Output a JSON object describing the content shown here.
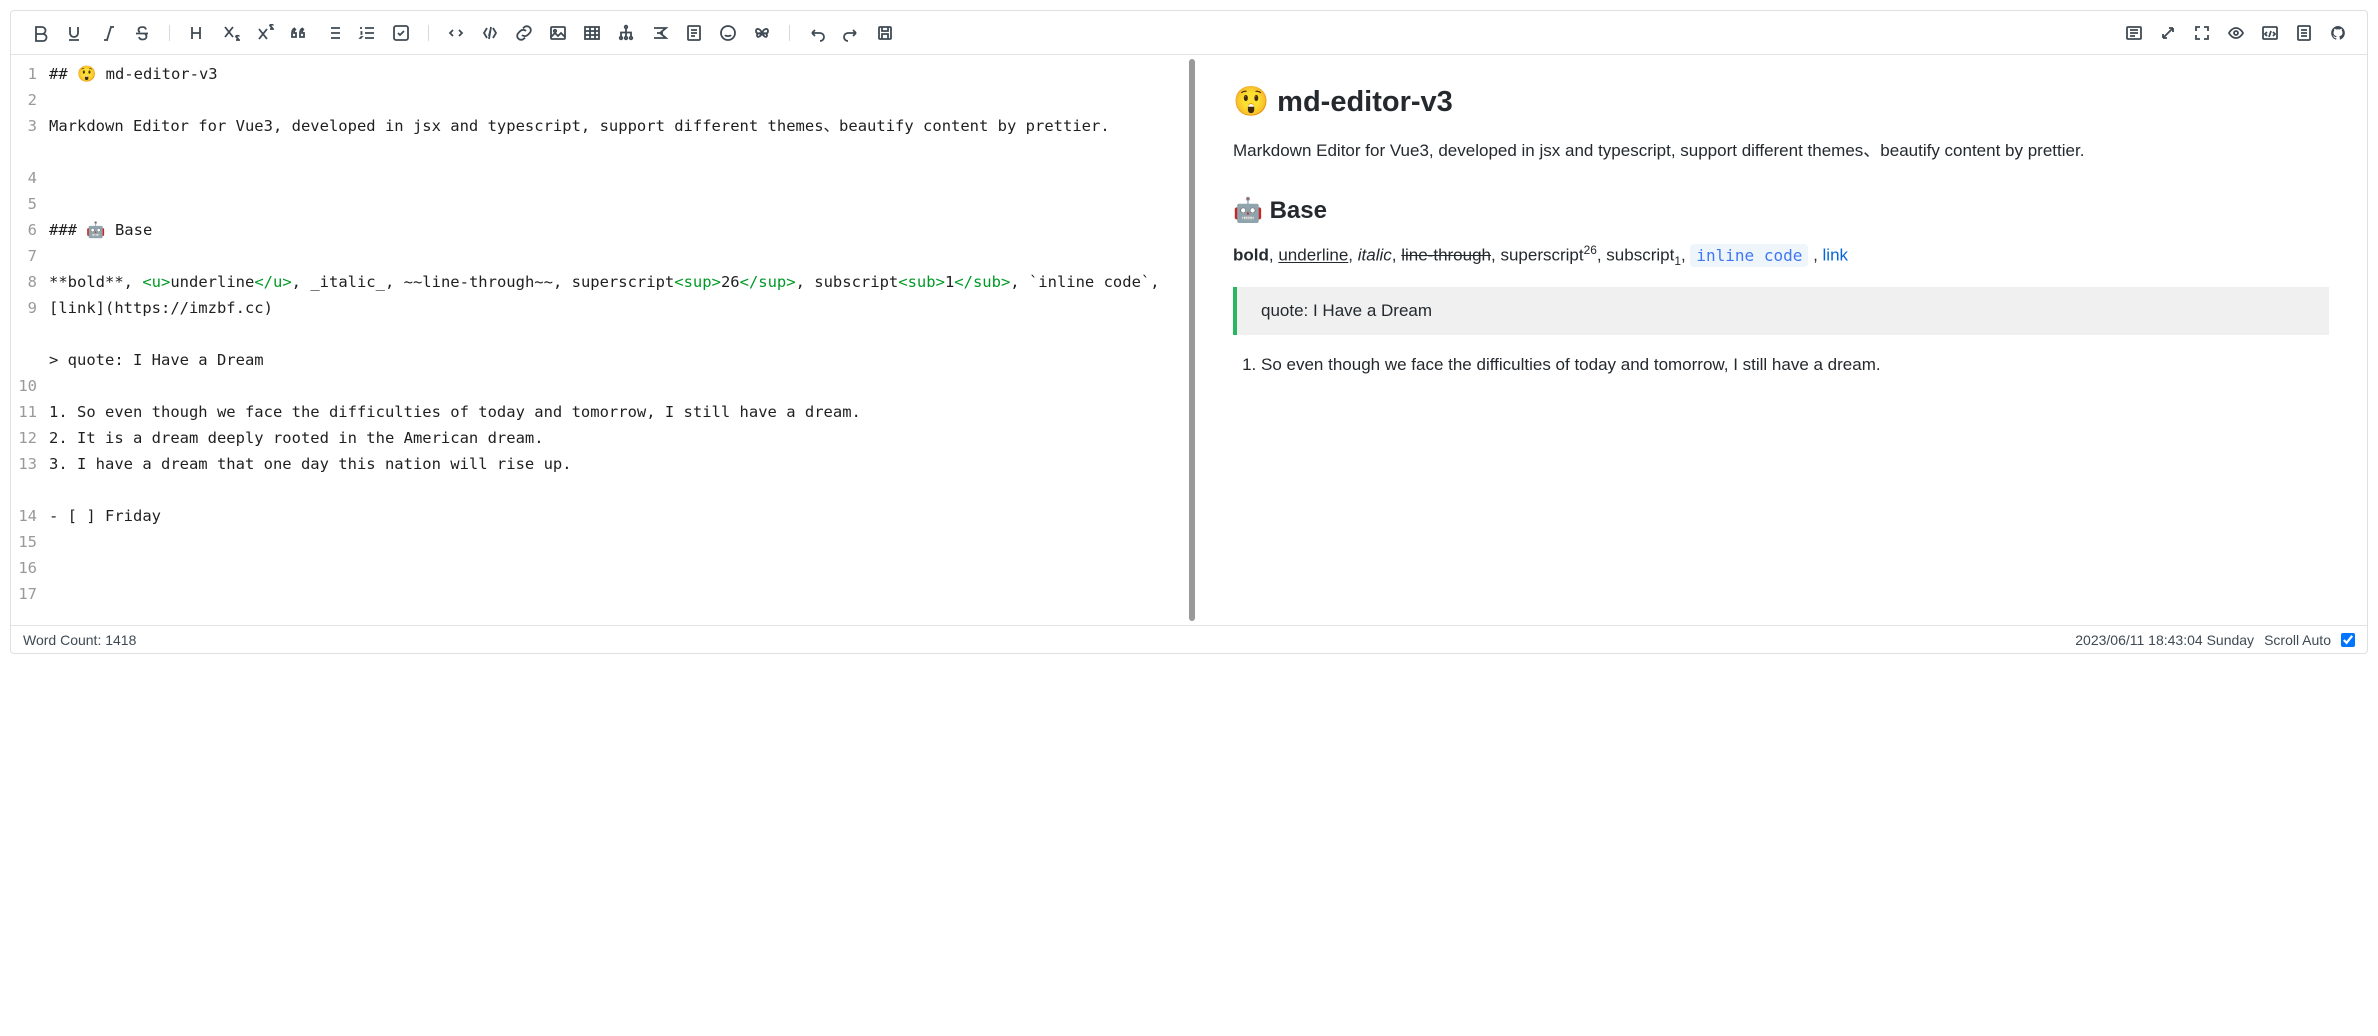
{
  "toolbar": {
    "left": [
      {
        "name": "bold",
        "svg": "<path d='M5 3h6a3.5 3.5 0 010 7H5zM5 10h7a3.5 3.5 0 010 7H5z'/>"
      },
      {
        "name": "underline",
        "svg": "<path d='M5 3v6a4 4 0 008 0V3M4 16h10'/>"
      },
      {
        "name": "italic",
        "svg": "<path d='M11 3h4M5 16h4M12 3l-4 13'/>"
      },
      {
        "name": "strikethrough",
        "svg": "<path d='M13 5.5a3.5 3.5 0 00-3.5-2.5C7 3 5.5 4 5.5 6c0 1 .5 1.7 1.5 2M3 9.5h12M6 13a3.5 3.5 0 003.5 2.5c2.5 0 4-1.2 4-3 0-1-.5-1.8-1.5-2.3'/>"
      },
      {
        "sep": true
      },
      {
        "name": "heading",
        "svg": "<path d='M4 3v12M12 3v12M4 9h8'/>"
      },
      {
        "name": "subscript",
        "svg": "<path d='M3 3l8 10M11 3L3 13M14 16h3l-3-3.5c0-1 3-1 3 0'/>"
      },
      {
        "name": "superscript",
        "svg": "<path d='M3 5l8 10M11 5L3 15M14 5h3l-3-3.5c0-1 3-1 3 0'/>"
      },
      {
        "name": "quote",
        "svg": "<path d='M5 4c-2 1-3 3-3 5v4h4V9H4c0-2 1-3.5 2-4M13 4c-2 1-3 3-3 5v4h4V9h-2c0-2 1-3.5 2-4'/>"
      },
      {
        "name": "ul",
        "svg": "<path d='M7 4h9M7 9h9M7 14h9M3 4h.01M3 9h.01M3 14h.01'/>"
      },
      {
        "name": "ol",
        "svg": "<path d='M7 4h9M7 9h9M7 14h9M3 3v2M2.5 8h1v2h-1M2.5 13h1l-1 1h1'/>"
      },
      {
        "name": "task",
        "svg": "<rect x='2' y='2' width='14' height='14' rx='2'/><path d='M6 9l2 2 4-4'/>"
      },
      {
        "sep": true
      },
      {
        "name": "code-block",
        "svg": "<path d='M6 6l-3 3 3 3M12 6l3 3-3 3'/>"
      },
      {
        "name": "code",
        "svg": "<path d='M6 4l-3 5 3 5M12 4l3 5-3 5M10 3l-2 12'/><text x='7' y='12' font-size='7' fill='#3f4a54' stroke='none'>/</text>",
        "raw": "{/}"
      },
      {
        "name": "link",
        "svg": "<path d='M7 11a4 4 0 005.66 0l2-2a4 4 0 00-5.66-5.66l-1 1M11 7a4 4 0 00-5.66 0l-2 2a4 4 0 005.66 5.66l1-1'/>"
      },
      {
        "name": "image",
        "svg": "<rect x='2' y='3' width='14' height='12' rx='1'/><circle cx='6' cy='7' r='1.2'/><path d='M2 13l4-4 3 3 3-3 4 4'/>"
      },
      {
        "name": "table",
        "svg": "<rect x='2' y='3' width='14' height='12'/><path d='M2 7h14M2 11h14M7 3v12M12 3v12'/>"
      },
      {
        "name": "tree",
        "svg": "<circle cx='9' cy='3' r='1.3'/><circle cx='4' cy='14' r='1.3'/><circle cx='9' cy='14' r='1.3'/><circle cx='14' cy='14' r='1.3'/><path d='M9 4.5v4M9 8.5H4v4M9 8.5v4M9 8.5h5v4'/>"
      },
      {
        "name": "formula",
        "svg": "<path d='M3 4h12l-6 5 6 5H3M6 9h6'/>"
      },
      {
        "name": "note",
        "svg": "<rect x='3' y='2' width='12' height='14' rx='1'/><path d='M6 6h6M6 9h6M6 12h4'/>"
      },
      {
        "name": "emoji",
        "svg": "<circle cx='9' cy='9' r='7'/><path d='M6 11c1 1.5 5 1.5 6 0M6.5 7h.01M11.5 7h.01'/>"
      },
      {
        "name": "butterfly",
        "svg": "<path d='M9 9c-2-5-6-5-6-2s3 3 6 2zM9 9c2-5 6-5 6-2s-3 3-6 2zM9 9c-1.5 4-5 5-5 2.5s2-2.5 5-2.5zM9 9c1.5 4 5 5 5 2.5S12 9 9 9z'/>"
      },
      {
        "sep": true
      },
      {
        "name": "undo",
        "svg": "<path d='M4 9h8a4 4 0 010 8M4 9l3-3M4 9l3 3'/>"
      },
      {
        "name": "redo",
        "svg": "<path d='M14 9H6a4 4 0 000 8M14 9l-3-3M14 9l-3 3'/>"
      },
      {
        "name": "save",
        "svg": "<rect x='3' y='3' width='12' height='12' rx='1'/><path d='M6 3v4h6V3M6 15v-5h6v5'/>"
      }
    ],
    "right": [
      {
        "name": "page-view",
        "svg": "<rect x='2' y='3' width='14' height='12' rx='1'/><path d='M5 6h8M5 9h8M5 12h5'/>"
      },
      {
        "name": "expand",
        "svg": "<path d='M4 14L14 4M14 4h-4M14 4v4M4 14h4M4 14v-4'/>"
      },
      {
        "name": "fullscreen",
        "svg": "<path d='M3 7V3h4M15 7V3h-4M3 11v4h4M15 11v4h-4'/>"
      },
      {
        "name": "preview",
        "svg": "<path d='M2 9s2.5-5 7-5 7 5 7 5-2.5 5-7 5-7-5-7-5z'/><circle cx='9' cy='9' r='2'/>"
      },
      {
        "name": "html-preview",
        "svg": "<rect x='2' y='3' width='14' height='12' rx='1'/><path d='M6 8l-2 2 2 2M12 8l2 2-2 2M10 7l-2 6'/>"
      },
      {
        "name": "catalog",
        "svg": "<rect x='3' y='2' width='12' height='14' rx='1'/><path d='M6 6h6M6 9h6M6 12h6'/>"
      },
      {
        "name": "github",
        "svg": "<path d='M9 2a7 7 0 00-2.2 13.6c.35.07.48-.15.48-.34v-1.2c-1.95.43-2.36-.94-2.36-.94-.32-.8-.78-1.02-.78-1.02-.64-.43.05-.43.05-.43.7.05 1.07.72 1.07.72.63 1.07 1.64.76 2.04.58.06-.45.24-.76.44-.94-1.56-.18-3.2-.78-3.2-3.46 0-.77.27-1.4.72-1.88-.07-.18-.31-.9.07-1.87 0 0 .59-.19 1.93.72a6.7 6.7 0 013.5 0c1.34-.9 1.93-.72 1.93-.72.38.98.14 1.7.07 1.87.45.49.72 1.12.72 1.88 0 2.7-1.64 3.28-3.2 3.46.25.22.47.64.47 1.3v1.92c0 .19.13.4.48.34A7 7 0 009 2z' fill='#3f4a54' stroke='none'/>"
      }
    ]
  },
  "editor": {
    "lines": [
      {
        "n": 1,
        "html": "## 😲 md-editor-v3"
      },
      {
        "n": 2,
        "html": ""
      },
      {
        "n": 3,
        "html": "Markdown Editor for Vue3, developed in jsx and typescript, support different themes、beautify content by prettier."
      },
      {
        "n": 4,
        "html": ""
      },
      {
        "n": 5,
        "html": ""
      },
      {
        "n": 6,
        "html": ""
      },
      {
        "n": 7,
        "html": "### 🤖 Base"
      },
      {
        "n": 8,
        "html": ""
      },
      {
        "n": 9,
        "html": "**bold**, <span class='tag'>&lt;u&gt;</span>underline<span class='tag'>&lt;/u&gt;</span>, _italic_, ~~line-through~~, superscript<span class='tag'>&lt;sup&gt;</span>26<span class='tag'>&lt;/sup&gt;</span>, subscript<span class='tag'>&lt;sub&gt;</span>1<span class='tag'>&lt;/sub&gt;</span>, `inline code`, [link](https://imzbf.cc)"
      },
      {
        "n": 10,
        "html": ""
      },
      {
        "n": 11,
        "html": "> quote: I Have a Dream"
      },
      {
        "n": 12,
        "html": ""
      },
      {
        "n": 13,
        "html": "1. So even though we face the difficulties of today and tomorrow, I still have a dream."
      },
      {
        "n": 14,
        "html": "2. It is a dream deeply rooted in the American dream."
      },
      {
        "n": 15,
        "html": "3. I have a dream that one day this nation will rise up."
      },
      {
        "n": 16,
        "html": ""
      },
      {
        "n": 17,
        "html": "- [ ] Friday"
      }
    ]
  },
  "preview": {
    "h2_emoji": "😲",
    "h2": "md-editor-v3",
    "p1": "Markdown Editor for Vue3, developed in jsx and typescript, support different themes、beautify content by prettier.",
    "h3_emoji": "🤖",
    "h3": "Base",
    "fmt": {
      "bold": "bold",
      "underline": "underline",
      "italic": "italic",
      "strike": "line-through",
      "sup_label": "superscript",
      "sup_val": "26",
      "sub_label": "subscript",
      "sub_val": "1",
      "code": "inline code",
      "link": "link"
    },
    "quote": "quote: I Have a Dream",
    "ol1": "So even though we face the difficulties of today and tomorrow, I still have a dream."
  },
  "status": {
    "word_count_label": "Word Count:",
    "word_count": "1418",
    "timestamp": "2023/06/11 18:43:04 Sunday",
    "scroll_label": "Scroll Auto",
    "scroll_checked": true
  }
}
